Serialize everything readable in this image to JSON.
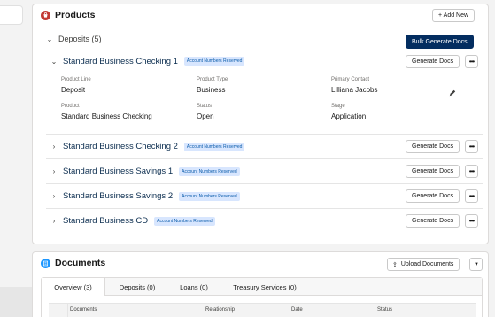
{
  "products": {
    "title": "Products",
    "icon": "products-icon",
    "add_new_label": "+ Add New",
    "deposits": {
      "label": "Deposits (5)",
      "bulk_button": "Bulk Generate Docs"
    },
    "expanded": {
      "name": "Standard Business Checking 1",
      "badge": "Account Numbers Reserved",
      "generate_label": "Generate Docs",
      "fields": {
        "product_line_label": "Product Line",
        "product_line": "Deposit",
        "product_type_label": "Product Type",
        "product_type": "Business",
        "primary_contact_label": "Primary Contact",
        "primary_contact": "Lilliana Jacobs",
        "product_label": "Product",
        "product": "Standard Business Checking",
        "status_label": "Status",
        "status": "Open",
        "stage_label": "Stage",
        "stage": "Application"
      }
    },
    "rows": [
      {
        "name": "Standard Business Checking 2",
        "badge": "Account Numbers Reserved",
        "generate_label": "Generate Docs"
      },
      {
        "name": "Standard Business Savings 1",
        "badge": "Account Numbers Reserved",
        "generate_label": "Generate Docs"
      },
      {
        "name": "Standard Business Savings 2",
        "badge": "Account Numbers Reserved",
        "generate_label": "Generate Docs"
      },
      {
        "name": "Standard Business CD",
        "badge": "Account Numbers Reserved",
        "generate_label": "Generate Docs"
      }
    ]
  },
  "documents": {
    "title": "Documents",
    "upload_label": "Upload Documents",
    "tabs": [
      {
        "label": "Overview (3)"
      },
      {
        "label": "Deposits (0)"
      },
      {
        "label": "Loans (0)"
      },
      {
        "label": "Treasury Services (0)"
      }
    ],
    "columns": [
      "Documents",
      "Relationship",
      "Date",
      "Status"
    ]
  },
  "colors": {
    "brand_dark": "#032d60",
    "badge_bg": "#d8e6fe",
    "badge_text": "#0b5cab",
    "products_icon": "#c23934",
    "documents_icon": "#1b96ff"
  }
}
